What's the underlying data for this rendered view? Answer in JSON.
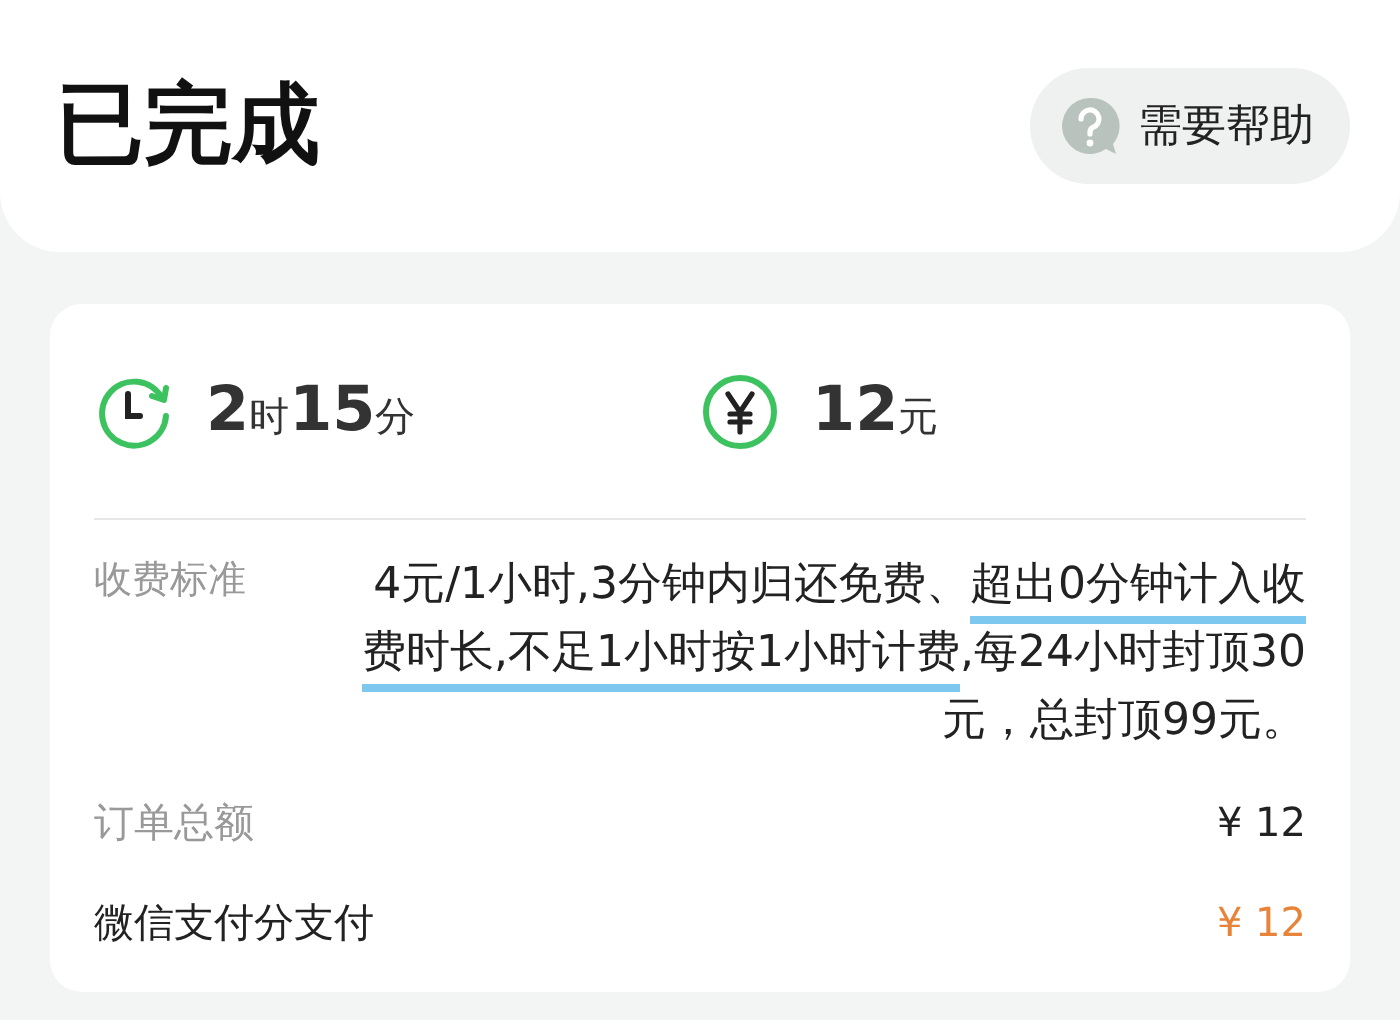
{
  "header": {
    "title": "已完成",
    "help_button": "需要帮助"
  },
  "stats": [
    {
      "kind": "clock",
      "parts": [
        {
          "text": "2",
          "kind": "number"
        },
        {
          "text": "时",
          "kind": "unit"
        },
        {
          "text": "15",
          "kind": "number"
        },
        {
          "text": "分",
          "kind": "unit"
        }
      ]
    },
    {
      "kind": "yen",
      "parts": [
        {
          "text": "12",
          "kind": "number"
        },
        {
          "text": "元",
          "kind": "unit"
        }
      ]
    }
  ],
  "fee_rule": {
    "label": "收费标准",
    "parts": [
      {
        "text": "4元/1小时,3分钟内归还免费、",
        "underlined": false
      },
      {
        "text": "超出0分钟计入收费时长,不足1小时按1小时计费",
        "underlined": true
      },
      {
        "text": ",每24小时封顶30元，总封顶99元。",
        "underlined": false
      }
    ]
  },
  "amounts": [
    {
      "label": "订单总额",
      "value": "¥ 12",
      "accent": false
    },
    {
      "label": "微信支付分支付",
      "value": "¥ 12",
      "accent": true
    }
  ]
}
